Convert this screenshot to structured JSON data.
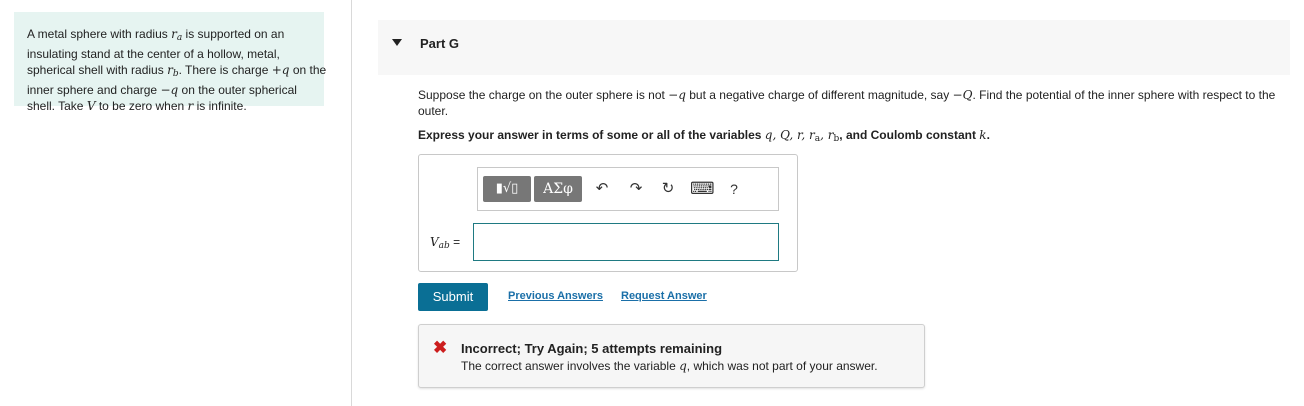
{
  "info": {
    "t1": "A metal sphere with radius ",
    "ra": "r",
    "ra_sub": "a",
    "t2": " is supported on an insulating stand at the center of a hollow, metal, spherical shell with radius ",
    "rb": "r",
    "rb_sub": "b",
    "t3": ". There is charge ",
    "plus_q": "+q",
    "t4": " on the inner sphere and charge ",
    "minus_q": "−q",
    "t5": " on the outer spherical shell. Take ",
    "V": "V",
    "t6": " to be zero when ",
    "r": "r",
    "t7": " is infinite."
  },
  "part": {
    "title": "Part G"
  },
  "question": {
    "t1": "Suppose the charge on the outer sphere is not ",
    "minus_q": "−q",
    "t2": " but a negative charge of different magnitude, say ",
    "minus_Q": "−Q",
    "t3": ". Find the potential of the inner sphere with respect to the outer."
  },
  "instruction": {
    "t1": "Express your answer in terms of some or all of the variables ",
    "vars": "q, Q, r, r",
    "ra_sub": "a",
    "comma": ", r",
    "rb_sub": "b",
    "t2": ", and Coulomb constant ",
    "k": "k",
    "t3": "."
  },
  "toolbar": {
    "templates_label": "▮√▯",
    "greek_label": "ΑΣφ",
    "undo_glyph": "↶",
    "redo_glyph": "↷",
    "reset_glyph": "↻",
    "keyboard_glyph": "⌨",
    "help_glyph": "?"
  },
  "answer": {
    "var": "V",
    "var_sub": "ab",
    "equals": " =",
    "value": ""
  },
  "actions": {
    "submit": "Submit",
    "previous": "Previous Answers",
    "request": "Request Answer"
  },
  "feedback": {
    "icon": "✖",
    "title": "Incorrect; Try Again; 5 attempts remaining",
    "body1": "The correct answer involves the variable ",
    "var": "q",
    "body2": ", which was not part of your answer."
  },
  "colors": {
    "info_bg": "#e6f4f1",
    "submit_bg": "#0a6f95",
    "link": "#1a6fa8",
    "error": "#cc1d1d",
    "input_border": "#1f7a82"
  }
}
